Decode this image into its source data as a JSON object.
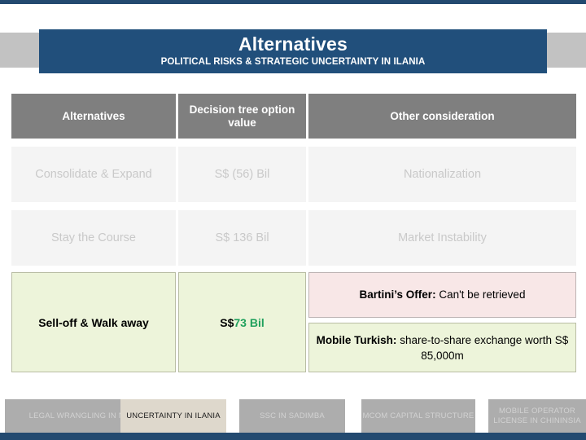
{
  "theme": {
    "accent_blue": "#214f7b",
    "header_gray": "#7f7f7f",
    "dim_row_bg": "#f4f4f4",
    "dim_text": "#c9c9c9",
    "highlight_green_bg": "#edf4da",
    "note_pink_bg": "#f8e7e7",
    "value_green": "#1fa05c",
    "nav_inactive_bg": "#adadad",
    "nav_active_bg": "#ded8cc"
  },
  "banner": {
    "title": "Alternatives",
    "subtitle": "POLITICAL RISKS & STRATEGIC UNCERTAINTY IN ILANIA"
  },
  "table": {
    "columns": [
      {
        "header": "Alternatives"
      },
      {
        "header": "Decision tree option value"
      },
      {
        "header": "Other consideration"
      }
    ],
    "rows": [
      {
        "state": "dim",
        "alternative": "Consolidate & Expand",
        "option_value": "S$ (56) Bil",
        "other_consideration": "Nationalization"
      },
      {
        "state": "dim",
        "alternative": "Stay the Course",
        "option_value": "S$ 136 Bil",
        "other_consideration": "Market Instability"
      },
      {
        "state": "highlight",
        "alternative": "Sell-off & Walk away",
        "option_value_prefix": "S$ ",
        "option_value_number": "73 Bil",
        "notes": [
          {
            "style": "pink",
            "lead": "Bartini’s Offer:",
            "rest": " Can't be retrieved"
          },
          {
            "style": "green",
            "lead": "Mobile Turkish:",
            "rest": " share-to-share exchange worth S$ 85,000m"
          }
        ]
      }
    ]
  },
  "bottom_nav": {
    "items": [
      {
        "label": "LEGAL WRANGLING IN NAKOLIA",
        "active": false
      },
      {
        "label": "UNCERTAINTY IN ILANIA",
        "active": true
      },
      {
        "label": "SSC IN SADIMBA",
        "active": false
      },
      {
        "label": "MCOM CAPITAL STRUCTURE",
        "active": false
      },
      {
        "label": "MOBILE OPERATOR LICENSE IN CHININSIA",
        "active": false
      }
    ]
  }
}
